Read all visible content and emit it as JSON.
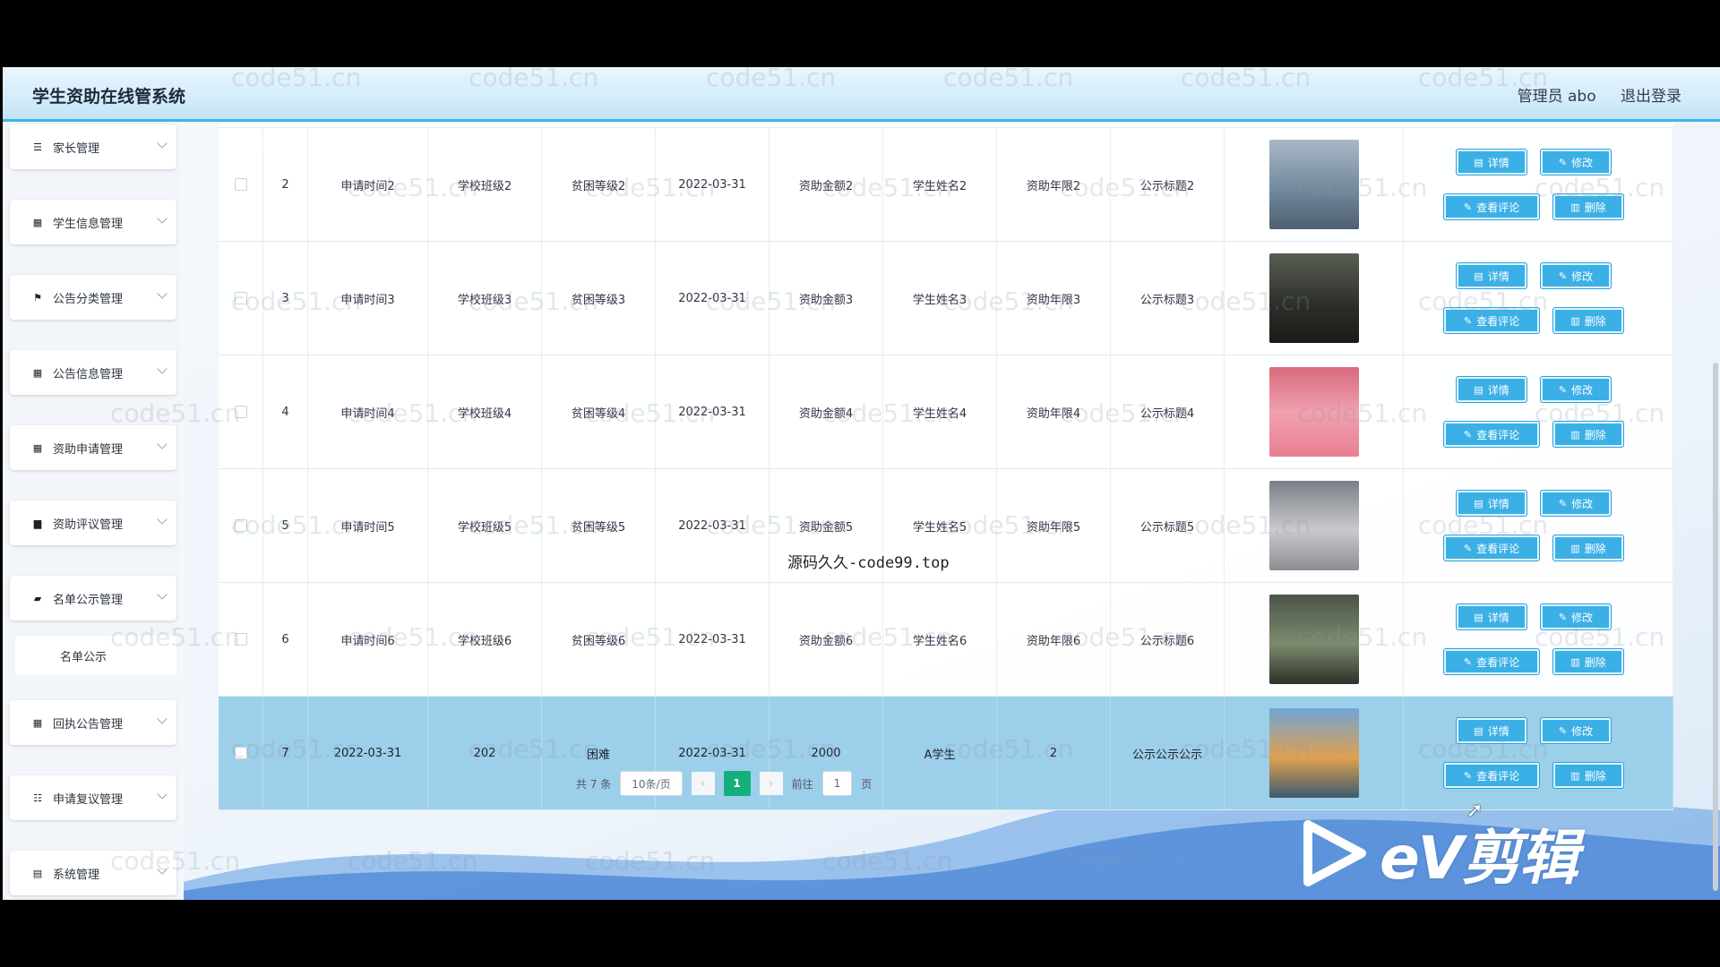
{
  "header": {
    "title": "学生资助在线管系统",
    "admin": "管理员 abo",
    "logout": "退出登录"
  },
  "sidebar": {
    "items": [
      {
        "label": "家长管理",
        "icon": "list-icon"
      },
      {
        "label": "学生信息管理",
        "icon": "grid-icon"
      },
      {
        "label": "公告分类管理",
        "icon": "flag-icon"
      },
      {
        "label": "公告信息管理",
        "icon": "grid-icon"
      },
      {
        "label": "资助申请管理",
        "icon": "grid-icon"
      },
      {
        "label": "资助评议管理",
        "icon": "chat-icon"
      },
      {
        "label": "名单公示管理",
        "icon": "folder-icon"
      },
      {
        "label": "回执公告管理",
        "icon": "grid-icon"
      },
      {
        "label": "申请复议管理",
        "icon": "sliders-icon"
      },
      {
        "label": "系统管理",
        "icon": "file-icon"
      }
    ],
    "submenu": "名单公示"
  },
  "actions": {
    "detail": "详情",
    "edit": "修改",
    "comments": "查看评论",
    "delete": "删除"
  },
  "rows": [
    {
      "idx": "2",
      "time": "申请时间2",
      "cls": "学校班级2",
      "level": "贫困等级2",
      "date": "2022-03-31",
      "amount": "资助金额2",
      "name": "学生姓名2",
      "years": "资助年限2",
      "title": "公示标题2",
      "selected": false
    },
    {
      "idx": "3",
      "time": "申请时间3",
      "cls": "学校班级3",
      "level": "贫困等级3",
      "date": "2022-03-31",
      "amount": "资助金额3",
      "name": "学生姓名3",
      "years": "资助年限3",
      "title": "公示标题3",
      "selected": false
    },
    {
      "idx": "4",
      "time": "申请时间4",
      "cls": "学校班级4",
      "level": "贫困等级4",
      "date": "2022-03-31",
      "amount": "资助金额4",
      "name": "学生姓名4",
      "years": "资助年限4",
      "title": "公示标题4",
      "selected": false
    },
    {
      "idx": "5",
      "time": "申请时间5",
      "cls": "学校班级5",
      "level": "贫困等级5",
      "date": "2022-03-31",
      "amount": "资助金额5",
      "name": "学生姓名5",
      "years": "资助年限5",
      "title": "公示标题5",
      "selected": false
    },
    {
      "idx": "6",
      "time": "申请时间6",
      "cls": "学校班级6",
      "level": "贫困等级6",
      "date": "2022-03-31",
      "amount": "资助金额6",
      "name": "学生姓名6",
      "years": "资助年限6",
      "title": "公示标题6",
      "selected": false
    },
    {
      "idx": "7",
      "time": "2022-03-31",
      "cls": "202",
      "level": "困难",
      "date": "2022-03-31",
      "amount": "2000",
      "name": "A学生",
      "years": "2",
      "title": "公示公示公示",
      "selected": true
    }
  ],
  "pagination": {
    "total": "共 7 条",
    "page_size": "10条/页",
    "current": "1",
    "goto_label": "前往",
    "goto_value": "1",
    "page_suffix": "页"
  },
  "watermark": "code51.cn",
  "overlay_text": "源码久久-code99.top",
  "video_logo": "eV剪辑",
  "colors": {
    "accent": "#3bb0e6",
    "header_border": "#3fb4ea",
    "selected_row": "#9ccfe9",
    "current_page": "#14b07b"
  }
}
